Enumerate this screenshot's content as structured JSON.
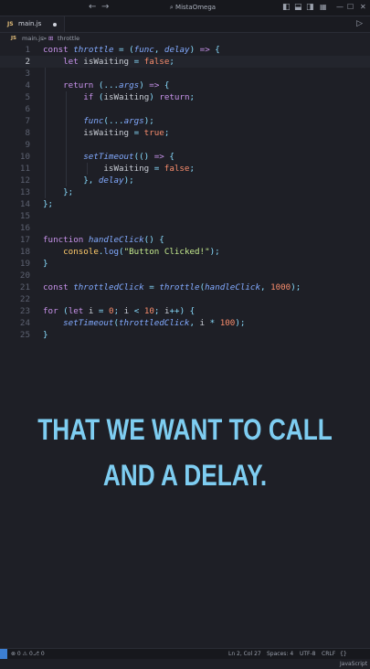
{
  "titlebar": {
    "search_text": "MistaOmega",
    "icons": [
      "back-arrow-icon",
      "forward-arrow-icon",
      "search-icon",
      "toggle-sidebar-icon",
      "toggle-panel-icon",
      "split-editor-icon",
      "customize-layout-icon"
    ]
  },
  "tab": {
    "file_badge": "JS",
    "file_name": "main.js"
  },
  "breadcrumb": {
    "file_badge": "JS",
    "file": "main.js",
    "separator": ">",
    "symbol_icon": "⊞",
    "symbol": "throttle"
  },
  "code": {
    "active_line": 2,
    "line_numbers": [
      "1",
      "2",
      "3",
      "4",
      "5",
      "6",
      "7",
      "8",
      "9",
      "10",
      "11",
      "12",
      "13",
      "14",
      "15",
      "16",
      "17",
      "18",
      "19",
      "20",
      "21",
      "22",
      "23",
      "24",
      "25"
    ]
  },
  "caption": {
    "line1": "THAT WE WANT TO CALL",
    "line2": "AND A DELAY."
  },
  "statusbar": {
    "problems": "⊗ 0 ⚠ 0",
    "ports": "⎇ 0",
    "position": "Ln 2, Col 27",
    "spaces": "Spaces: 4",
    "encoding": "UTF-8",
    "eol": "CRLF",
    "language": "{} JavaScript"
  },
  "colors": {
    "background": "#1e1f26",
    "caption": "#7ecdf1",
    "keyword": "#c792ea",
    "function": "#82aaff",
    "string": "#c3e88d",
    "number": "#f78c6c"
  }
}
